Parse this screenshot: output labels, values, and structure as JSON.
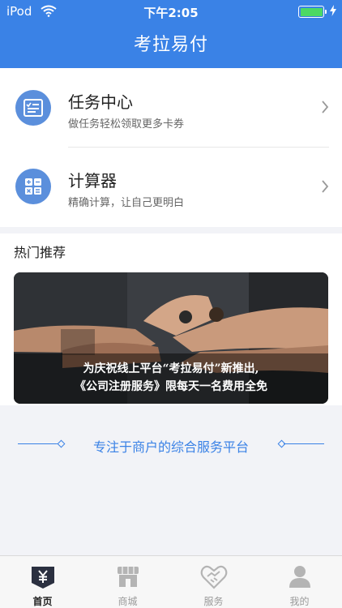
{
  "statusbar": {
    "carrier": "iPod",
    "time": "下午2:05"
  },
  "navbar": {
    "title": "考拉易付"
  },
  "menu": {
    "items": [
      {
        "title": "任务中心",
        "subtitle": "做任务轻松领取更多卡券",
        "icon": "task-list-icon"
      },
      {
        "title": "计算器",
        "subtitle": "精确计算，让自己更明白",
        "icon": "calculator-icon"
      }
    ]
  },
  "hot": {
    "title": "热门推荐",
    "banner": {
      "line1": "为庆祝线上平台“考拉易付”新推出,",
      "line2": "《公司注册服务》限每天一名费用全免"
    }
  },
  "slogan": "专注于商户的综合服务平台",
  "tabbar": {
    "tabs": [
      {
        "label": "首页",
        "icon": "home-yuan-icon",
        "active": true
      },
      {
        "label": "商城",
        "icon": "store-icon",
        "active": false
      },
      {
        "label": "服务",
        "icon": "handshake-heart-icon",
        "active": false
      },
      {
        "label": "我的",
        "icon": "user-icon",
        "active": false
      }
    ]
  },
  "colors": {
    "primary": "#3a82e6",
    "icon_bg": "#5b8fdc",
    "battery": "#4cd964"
  }
}
